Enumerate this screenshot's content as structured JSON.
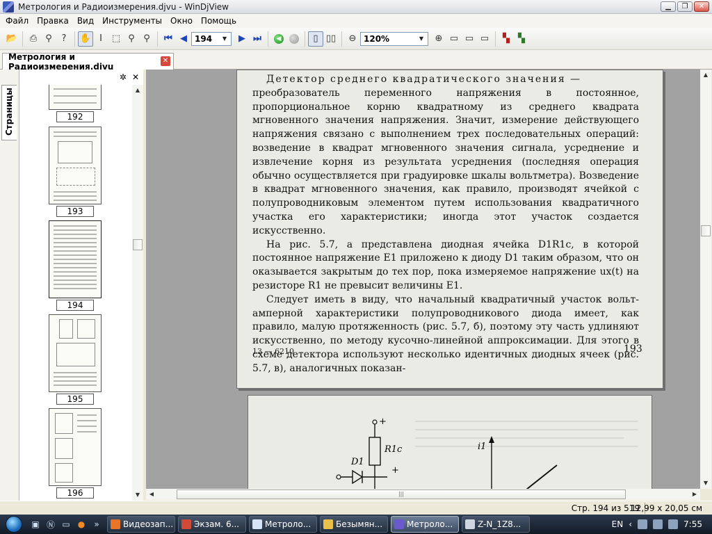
{
  "window": {
    "title": "Метрология и Радиоизмерения.djvu - WinDjView"
  },
  "menu": [
    "Файл",
    "Правка",
    "Вид",
    "Инструменты",
    "Окно",
    "Помощь"
  ],
  "toolbar": {
    "page": "194",
    "zoom": "120%"
  },
  "tab": {
    "label": "Метрология и Радиоизмерения.djvu"
  },
  "sidebar": {
    "tab_label": "Страницы",
    "thumbs": [
      "192",
      "193",
      "194",
      "195",
      "196"
    ]
  },
  "page": {
    "p1_lead": "Детектор среднего квадратического значения —",
    "p1": "преобразователь переменного напряжения в постоянное, пропорциональное корню квадратному из среднего квадрата мгновенного значения напряжения. Значит, измерение действующего напряжения связано с выполнением трех последовательных операций: возведение в квадрат мгновенного значения сигнала, усреднение и извлечение корня из результата усреднения (последняя операция обычно осуществляется при градуировке шкалы вольтметра). Возведение в квадрат мгновенного значения, как правило, производят ячейкой с полупроводниковым элементом путем использования квадратичного участка его характеристики; иногда этот участок создается искусственно.",
    "p2": "На рис. 5.7, а представлена диодная ячейка D1R1c, в которой постоянное напряжение E1 приложено к диоду D1 таким образом, что он оказывается закрытым до тех пор, пока измеряемое напряжение ux(t) на резисторе R1 не превысит величины E1.",
    "p3": "Следует иметь в виду, что начальный квадратичный участок вольт-амперной характеристики полупроводникового диода имеет, как правило, малую протяженность (рис. 5.7, б), поэтому эту часть удлиняют искусственно, по методу кусочно-линейной аппроксимации. Для этого в схеме детектора используют несколько идентичных диодных ячеек (рис. 5.7, в), аналогичных показан-",
    "footer_left": "13 — 6210",
    "footer_right": "193",
    "fig_r": "R1c",
    "fig_d": "D1",
    "fig_i": "i1",
    "fig_plus": "+"
  },
  "status": {
    "page_info": "Стр. 194 из 519",
    "page_size": "12,99 x 20,05 см"
  },
  "taskbar": {
    "tasks": [
      "Видеозап...",
      "Экзам. 6...",
      "Метроло...",
      "Безымян...",
      "Метроло...",
      "Z-N_1Z8..."
    ],
    "lang": "EN",
    "time": "7:55"
  }
}
